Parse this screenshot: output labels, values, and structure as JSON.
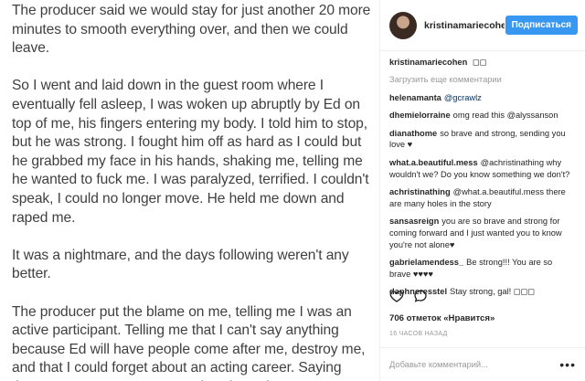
{
  "story": {
    "paragraphs": [
      "The producer said we would stay for just another 20 more minutes to smooth everything over, and then we could leave.",
      "So I went and laid down in the guest room where I eventually fell asleep, I was woken up abruptly by Ed on top of me, his fingers entering my body. I told him to stop, but he was strong. I fought him off as hard as I could but he grabbed my face in his hands, shaking me, telling me he wanted to fuck me. I was paralyzed, terrified. I couldn't speak, I could no longer move. He held me down and raped me.",
      "It was a nightmare, and the days following weren't any better.",
      "The producer put the blame on me, telling me I was an active participant. Telling me that I can't say anything because Ed will have people come after me, destroy me, and that I could forget about an acting career. Saying there's no way I can go around saying Ed"
    ]
  },
  "header": {
    "username": "kristinamariecohe",
    "follow_label": "Подписаться"
  },
  "caption": {
    "author": "kristinamariecohen",
    "text": "◻◻"
  },
  "load_more_label": "Загрузить еще комментарии",
  "comments": [
    {
      "author": "helenamanta",
      "text": "@gcrawlz"
    },
    {
      "author": "dhemielorraine",
      "text": "omg read this @alyssanson"
    },
    {
      "author": "dianathome",
      "text": "so brave and strong, sending you love ♥"
    },
    {
      "author": "what.a.beautiful.mess",
      "text": "@achristinathing why wouldn't we? Do you know something we don't?"
    },
    {
      "author": "achristinathing",
      "text": "@what.a.beautiful.mess there are many holes in the story"
    },
    {
      "author": "sansasreign",
      "text": "you are so brave and strong for coming forward and I just wanted you to know you're not alone♥"
    },
    {
      "author": "gabrielamendess_",
      "text": "Be strong!!! You are so brave ♥♥♥♥"
    },
    {
      "author": "daphneresstel",
      "text": "Stay strong, gal! ◻◻◻"
    }
  ],
  "likes_label": "706 отметок «Нравится»",
  "time_label": "16 ЧАСОВ НАЗАД",
  "add_comment_placeholder": "Добавьте комментарий...",
  "more_label": "•••",
  "icons": {
    "like": "heart-icon",
    "comment": "comment-icon"
  }
}
